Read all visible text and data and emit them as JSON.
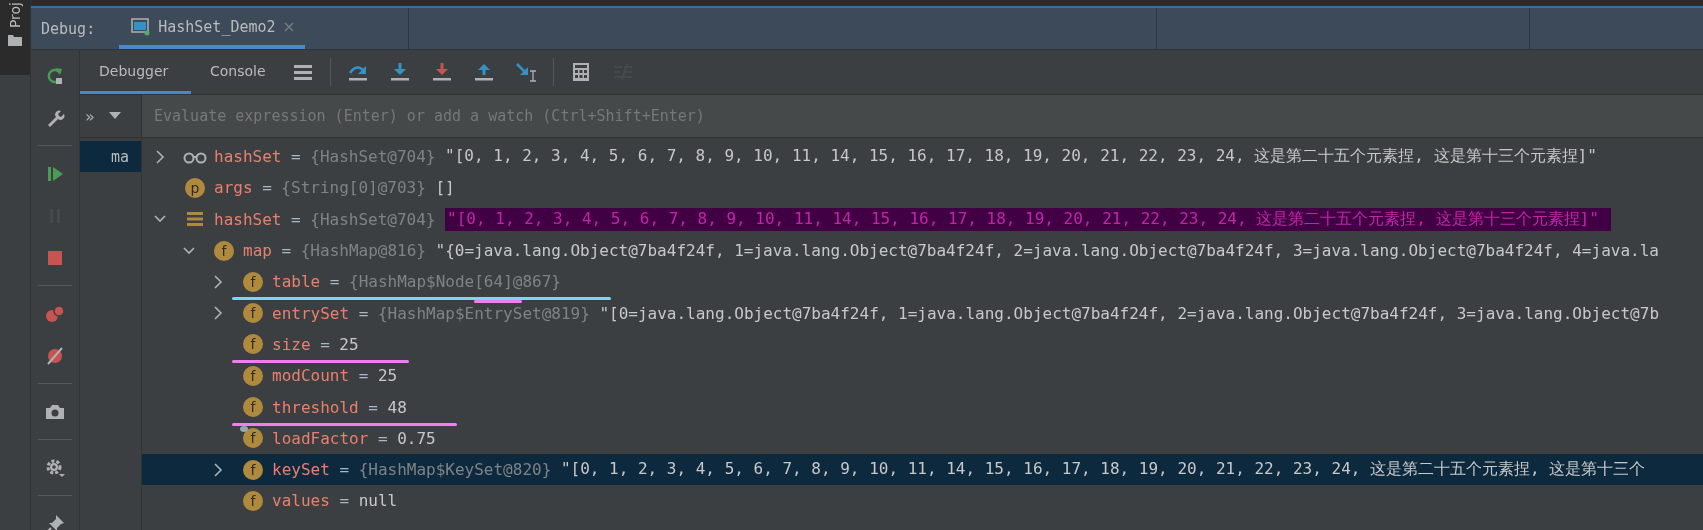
{
  "project_strip": {
    "label": "Proj"
  },
  "debug_header": {
    "label": "Debug:",
    "sessions": [
      {
        "label": "HashSet_Demo2",
        "selected": true
      }
    ]
  },
  "side_toolbar": [
    [
      {
        "kind": "rerun",
        "disabled": false
      },
      {
        "kind": "settings",
        "disabled": false
      }
    ],
    [
      {
        "kind": "resume",
        "disabled": false
      },
      {
        "kind": "pause",
        "disabled": true
      },
      {
        "kind": "stop",
        "disabled": false
      }
    ],
    [
      {
        "kind": "breakpoints",
        "disabled": false
      },
      {
        "kind": "mute",
        "disabled": false
      }
    ],
    [
      {
        "kind": "camera",
        "disabled": false
      }
    ],
    [
      {
        "kind": "gear",
        "disabled": false
      }
    ],
    [
      {
        "kind": "pin",
        "disabled": false
      }
    ]
  ],
  "tool_tabs": [
    {
      "label": "Debugger",
      "selected": true
    },
    {
      "label": "Console",
      "selected": false
    }
  ],
  "toolbar": [
    [
      {
        "kind": "menu",
        "disabled": false
      }
    ],
    [
      {
        "kind": "step_over",
        "disabled": false
      },
      {
        "kind": "step_into",
        "disabled": false
      },
      {
        "kind": "force_step_into",
        "disabled": false
      },
      {
        "kind": "step_out",
        "disabled": false
      },
      {
        "kind": "run_to_cursor",
        "disabled": false
      }
    ],
    [
      {
        "kind": "evaluate",
        "disabled": false
      },
      {
        "kind": "trace",
        "disabled": true
      }
    ]
  ],
  "watch": {
    "expand": "»",
    "placeholder": "Evaluate expression (Enter) or add a watch (Ctrl+Shift+Enter)"
  },
  "frames": [
    {
      "label": "ma",
      "selected": true
    }
  ],
  "tree": [
    {
      "kind": "watch",
      "name": "hashSet",
      "sep": "=",
      "type": "{HashSet@704}",
      "value": "\"[0, 1, 2, 3, 4, 5, 6, 7, 8, 9, 10, 11, 14, 15, 16, 17, 18, 19, 20, 21, 22, 23, 24, 这是第二十五个元素捏, 这是第十三个元素捏]\"",
      "expanded": false,
      "selected": false,
      "highlighted": false
    },
    {
      "kind": "param",
      "badge": "p",
      "name": "args",
      "sep": "=",
      "type": "{String[0]@703}",
      "value": "[]",
      "selected": false,
      "highlighted": false
    },
    {
      "kind": "local",
      "name": "hashSet",
      "sep": "=",
      "type": "{HashSet@704}",
      "value": "\"[0, 1, 2, 3, 4, 5, 6, 7, 8, 9, 10, 11, 14, 15, 16, 17, 18, 19, 20, 21, 22, 23, 24, 这是第二十五个元素捏, 这是第十三个元素捏]\"",
      "expanded": true,
      "selected": false,
      "highlighted": true,
      "children": [
        {
          "kind": "field",
          "badge": "f",
          "name": "map",
          "sep": "=",
          "type": "{HashMap@816}",
          "value": "\"{0=java.lang.Object@7ba4f24f, 1=java.lang.Object@7ba4f24f, 2=java.lang.Object@7ba4f24f, 3=java.lang.Object@7ba4f24f, 4=java.la",
          "expanded": true,
          "selected": false,
          "highlighted": false,
          "children": [
            {
              "kind": "field",
              "badge": "f",
              "name": "table",
              "sep": "=",
              "type": "{HashMap$Node[64]@867}",
              "expanded": false,
              "selected": false,
              "highlighted": false,
              "underline": {
                "color": "#7fd3f7"
              },
              "type_underline": {
                "color": "#f27df0"
              }
            },
            {
              "kind": "field",
              "badge": "f",
              "name": "entrySet",
              "sep": "=",
              "type": "{HashMap$EntrySet@819}",
              "value": "\"[0=java.lang.Object@7ba4f24f, 1=java.lang.Object@7ba4f24f, 2=java.lang.Object@7ba4f24f, 3=java.lang.Object@7b",
              "expanded": false,
              "selected": false,
              "highlighted": false
            },
            {
              "kind": "field",
              "badge": "f",
              "name": "size",
              "sep": "=",
              "value": "25",
              "selected": false,
              "highlighted": false,
              "underline": {
                "color": "#f27df0"
              }
            },
            {
              "kind": "field",
              "badge": "f",
              "name": "modCount",
              "sep": "=",
              "value": "25",
              "selected": false,
              "highlighted": false
            },
            {
              "kind": "field",
              "badge": "f",
              "name": "threshold",
              "sep": "=",
              "value": "48",
              "selected": false,
              "highlighted": false,
              "underline": {
                "color": "#f27df0"
              }
            },
            {
              "kind": "field_static",
              "badge": "f",
              "name": "loadFactor",
              "sep": "=",
              "value": "0.75",
              "selected": false,
              "highlighted": false
            },
            {
              "kind": "field",
              "badge": "f",
              "name": "keySet",
              "sep": "=",
              "type": "{HashMap$KeySet@820}",
              "value": "\"[0, 1, 2, 3, 4, 5, 6, 7, 8, 9, 10, 11, 14, 15, 16, 17, 18, 19, 20, 21, 22, 23, 24, 这是第二十五个元素捏, 这是第十三个",
              "expanded": false,
              "selected": true,
              "highlighted": false
            },
            {
              "kind": "field",
              "badge": "f",
              "name": "values",
              "sep": "=",
              "value": "null",
              "selected": false,
              "highlighted": false
            }
          ]
        }
      ]
    }
  ]
}
